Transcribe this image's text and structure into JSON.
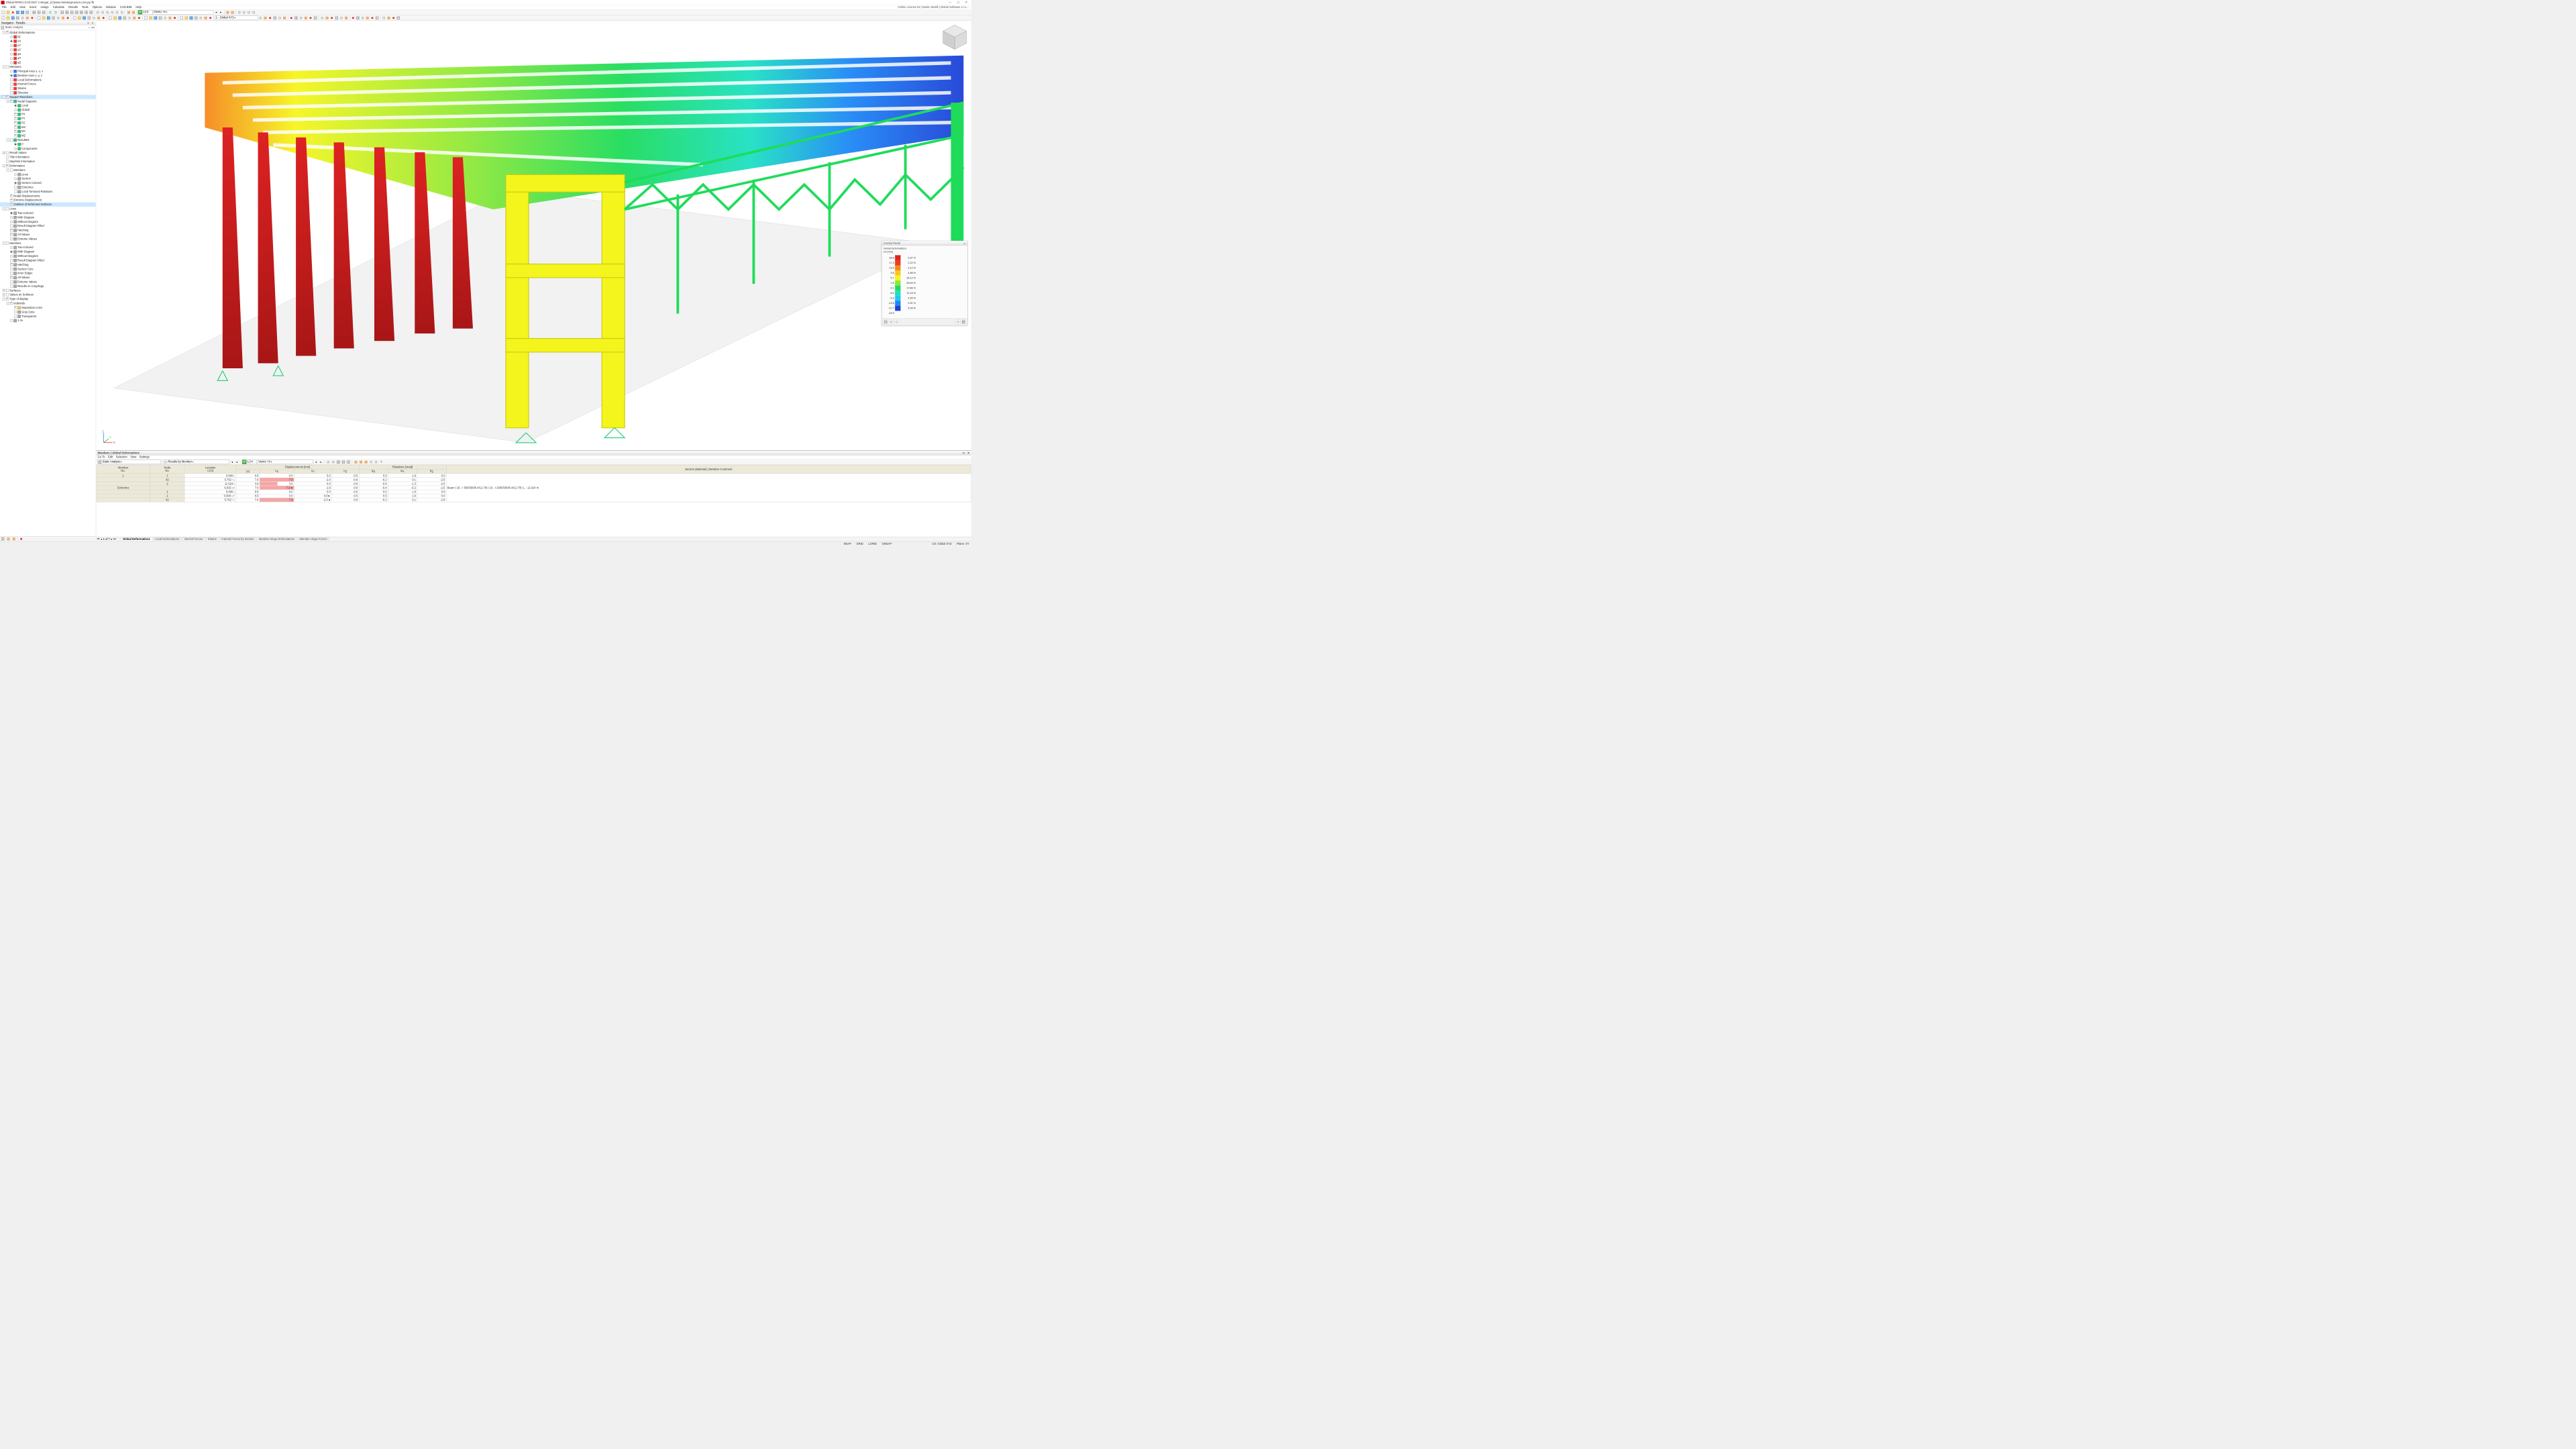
{
  "title": "Dlubal RFEM | 6.02.0047 | Hangar_(C)www.metalurgicavera.com.py.rf5",
  "license": "Online License 53 | Martin Motlík | Dlubal Software s.r.o...",
  "menu": [
    "File",
    "Edit",
    "View",
    "Insert",
    "Assign",
    "Calculate",
    "Results",
    "Tools",
    "Options",
    "Window",
    "CAD-BIM",
    "Help"
  ],
  "toolbar1": {
    "loadcase_w": "W",
    "loadcase": "LC4",
    "loadcase_name": "Viento +X"
  },
  "toolbar2": {
    "coord": "1 - Global XYZ"
  },
  "navigator": {
    "title": "Navigator - Results",
    "combo": "Static Analysis",
    "tree": [
      {
        "d": 0,
        "e": "-",
        "c": "on",
        "i": "",
        "l": "Global Deformations"
      },
      {
        "d": 1,
        "r": "off",
        "i": "red",
        "l": "|u|"
      },
      {
        "d": 1,
        "r": "on",
        "i": "red",
        "l": "uX"
      },
      {
        "d": 1,
        "r": "off",
        "i": "red",
        "l": "uY"
      },
      {
        "d": 1,
        "r": "off",
        "i": "red",
        "l": "uZ"
      },
      {
        "d": 1,
        "r": "off",
        "i": "red",
        "l": "φX"
      },
      {
        "d": 1,
        "r": "off",
        "i": "red",
        "l": "φY"
      },
      {
        "d": 1,
        "r": "off",
        "i": "red",
        "l": "φZ"
      },
      {
        "d": 0,
        "e": "-",
        "c": "off",
        "i": "",
        "l": "Members"
      },
      {
        "d": 1,
        "r": "off",
        "i": "blue",
        "l": "Principal Axes s, u, v"
      },
      {
        "d": 1,
        "r": "on",
        "i": "blue",
        "l": "Member Axes x, y, z"
      },
      {
        "d": 1,
        "c": "off",
        "i": "red",
        "l": "Local Deformations"
      },
      {
        "d": 1,
        "c": "off",
        "i": "red",
        "l": "Internal Forces"
      },
      {
        "d": 1,
        "c": "off",
        "i": "red",
        "l": "Strains"
      },
      {
        "d": 1,
        "c": "off",
        "i": "red",
        "l": "Stresses"
      },
      {
        "d": 0,
        "e": "-",
        "c": "on",
        "i": "",
        "l": "Support Reactions",
        "sel": true
      },
      {
        "d": 1,
        "e": "-",
        "c": "on",
        "i": "grn",
        "l": "Nodal Supports"
      },
      {
        "d": 2,
        "r": "on",
        "i": "grn",
        "l": "Local"
      },
      {
        "d": 2,
        "r": "off",
        "i": "grn",
        "l": "Global"
      },
      {
        "d": 2,
        "c": "on",
        "i": "grn",
        "l": "PX"
      },
      {
        "d": 2,
        "c": "on",
        "i": "grn",
        "l": "PY"
      },
      {
        "d": 2,
        "c": "on",
        "i": "grn",
        "l": "PZ"
      },
      {
        "d": 2,
        "c": "on",
        "i": "grn",
        "l": "MX"
      },
      {
        "d": 2,
        "c": "on",
        "i": "grn",
        "l": "MY"
      },
      {
        "d": 2,
        "c": "on",
        "i": "grn",
        "l": "MZ"
      },
      {
        "d": 1,
        "e": "-",
        "c": "off",
        "i": "grn",
        "l": "Resultant"
      },
      {
        "d": 2,
        "r": "on",
        "i": "grn",
        "l": "P"
      },
      {
        "d": 2,
        "r": "off",
        "i": "grn",
        "l": "Components"
      },
      {
        "d": 0,
        "e": "+",
        "c": "off",
        "i": "",
        "l": "Result Values"
      },
      {
        "d": 0,
        "c": "off",
        "i": "",
        "l": "Title Information"
      },
      {
        "d": 0,
        "c": "off",
        "i": "",
        "l": "Max/Min Information"
      },
      {
        "d": 0,
        "e": "-",
        "c": "on",
        "i": "",
        "l": "Deformation"
      },
      {
        "d": 1,
        "e": "-",
        "c": "off",
        "i": "",
        "l": "Members"
      },
      {
        "d": 2,
        "r": "off",
        "i": "gray",
        "l": "Lines"
      },
      {
        "d": 2,
        "r": "off",
        "i": "gray",
        "l": "Section"
      },
      {
        "d": 2,
        "r": "on",
        "i": "gray",
        "l": "Section Colored"
      },
      {
        "d": 2,
        "c": "off",
        "i": "gray",
        "l": "Extremes"
      },
      {
        "d": 2,
        "c": "off",
        "i": "gray",
        "l": "Local Torsional Rotations"
      },
      {
        "d": 1,
        "c": "on",
        "i": "",
        "l": "Nodal Displacements"
      },
      {
        "d": 1,
        "c": "on",
        "i": "",
        "l": "Extreme Displacement"
      },
      {
        "d": 1,
        "c": "on",
        "i": "",
        "l": "Outlines of Deformed Surfaces",
        "sel": true
      },
      {
        "d": 0,
        "e": "-",
        "c": "off",
        "i": "",
        "l": "Lines"
      },
      {
        "d": 1,
        "r": "on",
        "i": "gray",
        "l": "Two-Colored"
      },
      {
        "d": 1,
        "r": "off",
        "i": "gray",
        "l": "With Diagram"
      },
      {
        "d": 1,
        "r": "off",
        "i": "gray",
        "l": "Without Diagram"
      },
      {
        "d": 1,
        "c": "off",
        "i": "gray",
        "l": "Result Diagram Filled"
      },
      {
        "d": 1,
        "c": "on",
        "i": "gray",
        "l": "Hatching"
      },
      {
        "d": 1,
        "c": "on",
        "i": "gray",
        "l": "All Values"
      },
      {
        "d": 1,
        "c": "off",
        "i": "gray",
        "l": "Extreme Values"
      },
      {
        "d": 0,
        "e": "-",
        "c": "off",
        "i": "",
        "l": "Members"
      },
      {
        "d": 1,
        "r": "off",
        "i": "gray",
        "l": "Two-Colored"
      },
      {
        "d": 1,
        "r": "on",
        "i": "gray",
        "l": "With Diagram"
      },
      {
        "d": 1,
        "r": "off",
        "i": "gray",
        "l": "Without Diagram"
      },
      {
        "d": 1,
        "c": "off",
        "i": "gray",
        "l": "Result Diagram Filled"
      },
      {
        "d": 1,
        "c": "on",
        "i": "gray",
        "l": "Hatching"
      },
      {
        "d": 1,
        "c": "off",
        "i": "gray",
        "l": "Section Cuts"
      },
      {
        "d": 1,
        "c": "off",
        "i": "gray",
        "l": "Inner Edges"
      },
      {
        "d": 1,
        "c": "on",
        "i": "gray",
        "l": "All Values"
      },
      {
        "d": 1,
        "c": "off",
        "i": "gray",
        "l": "Extreme Values"
      },
      {
        "d": 1,
        "c": "off",
        "i": "gray",
        "l": "Results on Couplings"
      },
      {
        "d": 0,
        "e": "+",
        "c": "off",
        "i": "",
        "l": "Surfaces"
      },
      {
        "d": 0,
        "e": "+",
        "c": "off",
        "i": "",
        "l": "Values on Surfaces"
      },
      {
        "d": 0,
        "e": "-",
        "c": "on",
        "i": "",
        "l": "Type of display"
      },
      {
        "d": 1,
        "e": "-",
        "c": "on",
        "i": "",
        "l": "Isobands"
      },
      {
        "d": 2,
        "c": "on",
        "i": "yel",
        "l": "Separation Lines"
      },
      {
        "d": 2,
        "c": "off",
        "i": "gray",
        "l": "Gray Zone"
      },
      {
        "d": 2,
        "c": "off",
        "i": "gray",
        "l": "Transparent"
      },
      {
        "d": 1,
        "c": "off",
        "i": "gray",
        "l": "1 σv"
      }
    ]
  },
  "controlPanel": {
    "title": "Control Panel",
    "heading": "Global Deformations",
    "unit": "uX [mm]",
    "ramp": [
      {
        "v": "36.8",
        "c": "#dd2222",
        "p": "3.37 %"
      },
      {
        "v": "17.4",
        "c": "#ef3a1f",
        "p": "2.22 %"
      },
      {
        "v": "13.5",
        "c": "#f6881e",
        "p": "3.12 %"
      },
      {
        "v": "9.6",
        "c": "#f8c71e",
        "p": "4.66 %"
      },
      {
        "v": "5.7",
        "c": "#f5f51e",
        "p": "18.12 %"
      },
      {
        "v": "1.8",
        "c": "#8ee83a",
        "p": "26.54 %"
      },
      {
        "v": "-2.1",
        "c": "#1edc5a",
        "p": "17.86 %"
      },
      {
        "v": "-6.0",
        "c": "#1ee0c3",
        "p": "11.16 %"
      },
      {
        "v": "-9.9",
        "c": "#1ec8f6",
        "p": "4.99 %"
      },
      {
        "v": "-13.8",
        "c": "#1e88f6",
        "p": "3.91 %"
      },
      {
        "v": "-17.7",
        "c": "#1e40d6",
        "p": "4.05 %"
      },
      {
        "v": "-29.9",
        "c": "",
        "p": ""
      }
    ]
  },
  "table": {
    "title": "Members | Global Deformations",
    "menu": [
      "Go To",
      "Edit",
      "Selection",
      "View",
      "Settings"
    ],
    "combo1": "Static Analysis",
    "combo2": "Results by Member",
    "lc_w": "W",
    "lc": "LC4",
    "lc_name": "Viento +X",
    "headerTop": [
      "Member",
      "Node",
      "Location",
      "",
      "Displacements [mm]",
      "",
      "",
      "",
      "Rotations [mrad]",
      "",
      ""
    ],
    "headerBot": [
      "No.",
      "No.",
      "x [m]",
      "|u|",
      "uX",
      "uY",
      "uZ",
      "φX",
      "φY",
      "φZ",
      ""
    ],
    "comment": "Section (Material) | Member Comment",
    "beam": "Beam | 15 - I 500/300/6.4/12.7/6 | 16 - I 2000/300/6.4/12.7/6 | L : 11.524 m",
    "rows": [
      {
        "m": "1",
        "n": "1",
        "x": "0.000",
        "xt": "ε",
        "u": "0.5",
        "ux": "0.0",
        "uy": "0.0",
        "uz": "-0.5",
        "rx": "0.5",
        "ry": "1.9",
        "rz": "0.0"
      },
      {
        "m": "",
        "n": "42",
        "x": "5.762",
        "xt": "¹/₂",
        "u": "7.6",
        "ux": "7.3",
        "uy": "-2.0",
        "uz": "-0.8",
        "rx": "-0.2",
        "ry": "0.1",
        "rz": "-2.9"
      },
      {
        "m": "",
        "n": "2",
        "x": "11.524",
        "xt": "ε",
        "u": "3.9",
        "ux": "3.8",
        "uy": "0.0",
        "uz": "-0.8",
        "rx": "-0.5",
        "ry": "-1.3",
        "rz": "-2.0"
      },
      {
        "m": "Extremes",
        "n": "",
        "x": "6.915",
        "xt": "ux",
        "u": "7.6",
        "ux": "7.3",
        "uxmark": "◄",
        "uy": "-1.9",
        "uz": "-0.8",
        "rx": "-0.4",
        "ry": "-0.2",
        "rz": "-2.5"
      },
      {
        "m": "",
        "n": "1",
        "x": "0.000",
        "xt": "ε",
        "u": "0.5",
        "ux": "0.0",
        "uy": "0.0",
        "uz": "-0.5",
        "rx": "0.5",
        "ry": "1.9",
        "rz": "0.0"
      },
      {
        "m": "",
        "n": "1",
        "x": "0.000",
        "xt": "uY",
        "u": "0.5",
        "ux": "0.0",
        "uy": "0.0",
        "uymark": "►",
        "uz": "-0.5",
        "rx": "0.5",
        "ry": "1.9",
        "rz": "0.0"
      },
      {
        "m": "",
        "n": "42",
        "x": "5.762",
        "xt": "¹/₂",
        "u": "7.6",
        "ux": "7.3",
        "uy": "-2.0",
        "uymark": "◄",
        "uz": "-0.8",
        "rx": "-0.2",
        "ry": "0.1",
        "rz": "-2.9"
      }
    ],
    "nav": {
      "pos": "1 of 7",
      "tabs": [
        "Global Deformations",
        "Local Deformations",
        "Internal Forces",
        "Strains",
        "Internal Forces by Section",
        "Member Hinge Deformations",
        "Member Hinge Forces"
      ]
    }
  },
  "status": {
    "cs": "CS: Global XYZ",
    "plane": "Plane: XY",
    "snap": "SNAP",
    "grid": "GRID",
    "lgrid": "LGRID",
    "osnap": "OSNAP"
  },
  "chart_data": {
    "type": "table",
    "title": "Global Deformations uX color ramp",
    "xlabel": "uX [mm]",
    "ylabel": "percentage",
    "series": [
      {
        "name": "range_upper_mm",
        "values": [
          36.8,
          17.4,
          13.5,
          9.6,
          5.7,
          1.8,
          -2.1,
          -6.0,
          -9.9,
          -13.8,
          -17.7,
          -29.9
        ]
      },
      {
        "name": "percent",
        "values": [
          3.37,
          2.22,
          3.12,
          4.66,
          18.12,
          26.54,
          17.86,
          11.16,
          4.99,
          3.91,
          4.05
        ]
      }
    ]
  }
}
